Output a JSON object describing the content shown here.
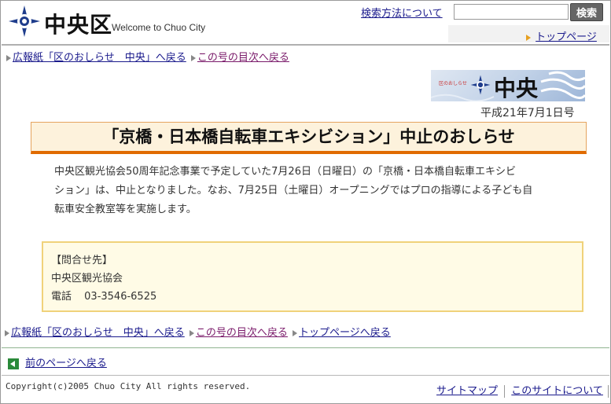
{
  "header": {
    "logo_text": "中央区",
    "tagline": "Welcome to Chuo City",
    "search_help_link": "検索方法について",
    "search_placeholder": "",
    "search_button": "検索",
    "top_page_link": "トップページ"
  },
  "breadcrumb_top": {
    "back_to_newsletter": "広報紙「区のおしらせ　中央」へ戻る",
    "back_to_toc": "この号の目次へ戻る"
  },
  "banner": {
    "small_text": "区のおしらせ",
    "big_text": "中央",
    "issue_date": "平成21年7月1日号"
  },
  "article": {
    "title": "「京橋・日本橋自転車エキシビション」中止のおしらせ",
    "body_line1": "中央区観光協会50周年記念事業で予定していた7月26日（日曜日）の「京橋・日本橋自転車エキシビ",
    "body_line2": "ション」は、中止となりました。なお、7月25日（土曜日）オープニングではプロの指導による子ども自",
    "body_line3": "転車安全教室等を実施します。"
  },
  "contact": {
    "heading": "【問合せ先】",
    "org": "中央区観光協会",
    "phone_label": "電話",
    "phone": "03-3546-6525"
  },
  "breadcrumb_bottom": {
    "back_to_newsletter": "広報紙「区のおしらせ　中央」へ戻る",
    "back_to_toc": "この号の目次へ戻る",
    "back_to_top": "トップページへ戻る"
  },
  "nav": {
    "prev_page": "前のページへ戻る"
  },
  "footer": {
    "copyright": "Copyright(c)2005 Chuo City All rights reserved.",
    "sitemap": "サイトマップ",
    "about_site": "このサイトについて"
  },
  "colors": {
    "title_border": "#e06a00",
    "title_bg": "#fdf2dc",
    "contact_border": "#f0d27a",
    "link": "#1a1a8c",
    "logo_blue": "#1f3d8c",
    "prev_icon_green": "#2a8a3a"
  }
}
